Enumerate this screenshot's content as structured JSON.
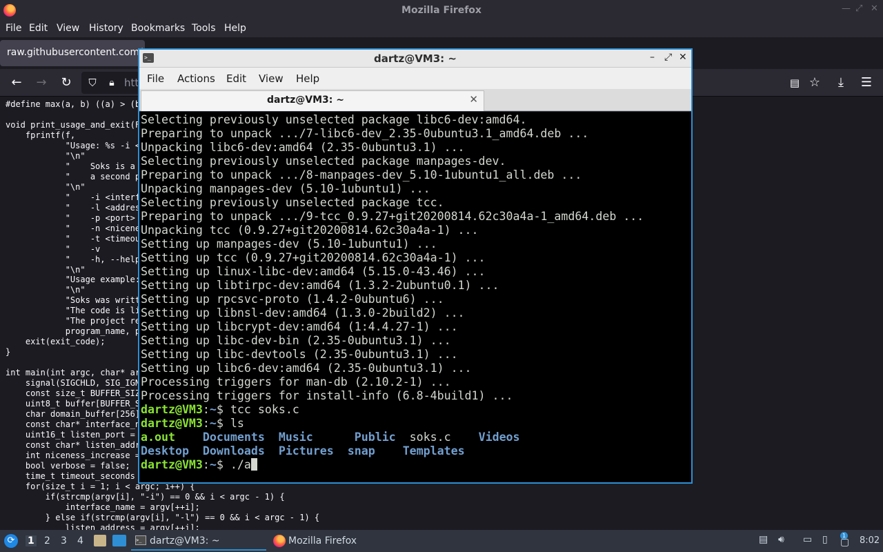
{
  "firefox": {
    "title": "Mozilla Firefox",
    "menu": [
      "File",
      "Edit",
      "View",
      "History",
      "Bookmarks",
      "Tools",
      "Help"
    ],
    "tab_title": "raw.githubusercontent.com/",
    "url_partial": "htt",
    "code_lines": [
      "#define max(a, b) ((a) > (b",
      "",
      "void print_usage_and_exit(F",
      "    fprintf(f,",
      "            \"Usage: %s -i <",
      "            \"\\n\"",
      "            \"    Soks is a",
      "            \"    a second p",
      "            \"\\n\"",
      "            \"    -i <interf",
      "            \"    -l <addres",
      "            \"    -p <port>",
      "            \"    -n <nicene",
      "            \"    -t <timeou",
      "            \"    -v",
      "            \"    -h, --help",
      "            \"\\n\"",
      "            \"Usage example:",
      "            \"\\n\"",
      "            \"Soks was writt",
      "            \"The code is li",
      "            \"The project re",
      "            program_name, p",
      "    exit(exit_code);",
      "}",
      "",
      "int main(int argc, char* ar",
      "    signal(SIGCHLD, SIG_IGN",
      "    const size_t BUFFER_SIZ",
      "    uint8_t buffer[BUFFER_S",
      "    char domain_buffer[256]",
      "    const char* interface_n",
      "    uint16_t listen_port =",
      "    const char* listen_addr",
      "    int niceness_increase =",
      "    bool verbose = false;",
      "    time_t timeout_seconds",
      "    for(size_t i = 1; i < argc; i++) {",
      "        if(strcmp(argv[i], \"-i\") == 0 && i < argc - 1) {",
      "            interface_name = argv[++i];",
      "        } else if(strcmp(argv[i], \"-l\") == 0 && i < argc - 1) {",
      "            listen_address = argv[++i];"
    ]
  },
  "terminal": {
    "window_title": "dartz@VM3: ~",
    "menu": [
      "File",
      "Actions",
      "Edit",
      "View",
      "Help"
    ],
    "tab_label": "dartz@VM3: ~",
    "tab_close": "✕",
    "output_lines": [
      "Selecting previously unselected package libc6-dev:amd64.",
      "Preparing to unpack .../7-libc6-dev_2.35-0ubuntu3.1_amd64.deb ...",
      "Unpacking libc6-dev:amd64 (2.35-0ubuntu3.1) ...",
      "Selecting previously unselected package manpages-dev.",
      "Preparing to unpack .../8-manpages-dev_5.10-1ubuntu1_all.deb ...",
      "Unpacking manpages-dev (5.10-1ubuntu1) ...",
      "Selecting previously unselected package tcc.",
      "Preparing to unpack .../9-tcc_0.9.27+git20200814.62c30a4a-1_amd64.deb ...",
      "Unpacking tcc (0.9.27+git20200814.62c30a4a-1) ...",
      "Setting up manpages-dev (5.10-1ubuntu1) ...",
      "Setting up tcc (0.9.27+git20200814.62c30a4a-1) ...",
      "Setting up linux-libc-dev:amd64 (5.15.0-43.46) ...",
      "Setting up libtirpc-dev:amd64 (1.3.2-2ubuntu0.1) ...",
      "Setting up rpcsvc-proto (1.4.2-0ubuntu6) ...",
      "Setting up libnsl-dev:amd64 (1.3.0-2build2) ...",
      "Setting up libcrypt-dev:amd64 (1:4.4.27-1) ...",
      "Setting up libc-dev-bin (2.35-0ubuntu3.1) ...",
      "Setting up libc-devtools (2.35-0ubuntu3.1) ...",
      "Setting up libc6-dev:amd64 (2.35-0ubuntu3.1) ...",
      "Processing triggers for man-db (2.10.2-1) ...",
      "Processing triggers for install-info (6.8-4build1) ..."
    ],
    "prompt_user": "dartz@VM3",
    "prompt_colon": ":",
    "prompt_path": "~",
    "prompt_dollar": "$ ",
    "commands": [
      "tcc soks.c",
      "ls",
      "./a"
    ],
    "ls_row1": [
      {
        "name": "a.out",
        "kind": "exec",
        "pad": "    "
      },
      {
        "name": "Documents",
        "kind": "dir",
        "pad": "  "
      },
      {
        "name": "Music",
        "kind": "dir",
        "pad": "      "
      },
      {
        "name": "Public",
        "kind": "dir",
        "pad": "  "
      },
      {
        "name": "soks.c",
        "kind": "file",
        "pad": "    "
      },
      {
        "name": "Videos",
        "kind": "dir",
        "pad": ""
      }
    ],
    "ls_row2": [
      {
        "name": "Desktop",
        "kind": "dir",
        "pad": "  "
      },
      {
        "name": "Downloads",
        "kind": "dir",
        "pad": "  "
      },
      {
        "name": "Pictures",
        "kind": "dir",
        "pad": "  "
      },
      {
        "name": "snap",
        "kind": "dir",
        "pad": "    "
      },
      {
        "name": "Templates",
        "kind": "dir",
        "pad": ""
      }
    ]
  },
  "taskbar": {
    "workspaces": [
      "1",
      "2",
      "3",
      "4"
    ],
    "tasks": [
      {
        "label": "dartz@VM3: ~",
        "icon": "terminal-icon"
      },
      {
        "label": "Mozilla Firefox",
        "icon": "firefox-icon"
      }
    ],
    "clock": "8:02",
    "notification_count": "1"
  }
}
